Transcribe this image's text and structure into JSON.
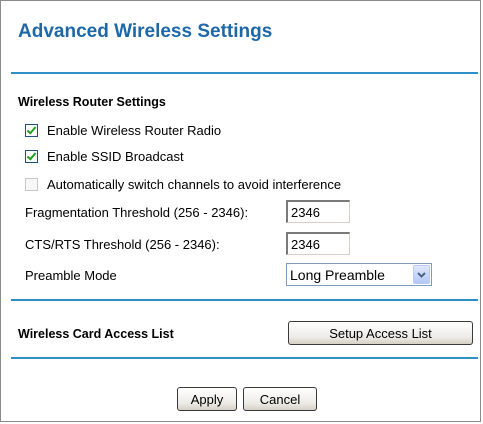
{
  "page": {
    "title": "Advanced Wireless Settings"
  },
  "router_settings": {
    "heading": "Wireless Router Settings",
    "enable_radio": {
      "label": "Enable Wireless Router Radio",
      "checked": true
    },
    "enable_ssid_broadcast": {
      "label": "Enable SSID Broadcast",
      "checked": true
    },
    "auto_channel": {
      "label": "Automatically switch channels to avoid interference",
      "checked": false,
      "enabled": false
    },
    "fragmentation": {
      "label": "Fragmentation Threshold (256 - 2346):",
      "value": "2346"
    },
    "cts_rts": {
      "label": "CTS/RTS Threshold (256 - 2346):",
      "value": "2346"
    },
    "preamble": {
      "label": "Preamble Mode",
      "selected": "Long Preamble"
    }
  },
  "access_list": {
    "heading": "Wireless Card Access List",
    "button_label": "Setup Access List"
  },
  "actions": {
    "apply_label": "Apply",
    "cancel_label": "Cancel"
  },
  "colors": {
    "title": "#1e68a8",
    "rule": "#2f8fc7",
    "checkmark": "#21a121"
  },
  "icons": {
    "checkbox_checked": "check-icon",
    "select_arrow": "chevron-down-icon"
  }
}
